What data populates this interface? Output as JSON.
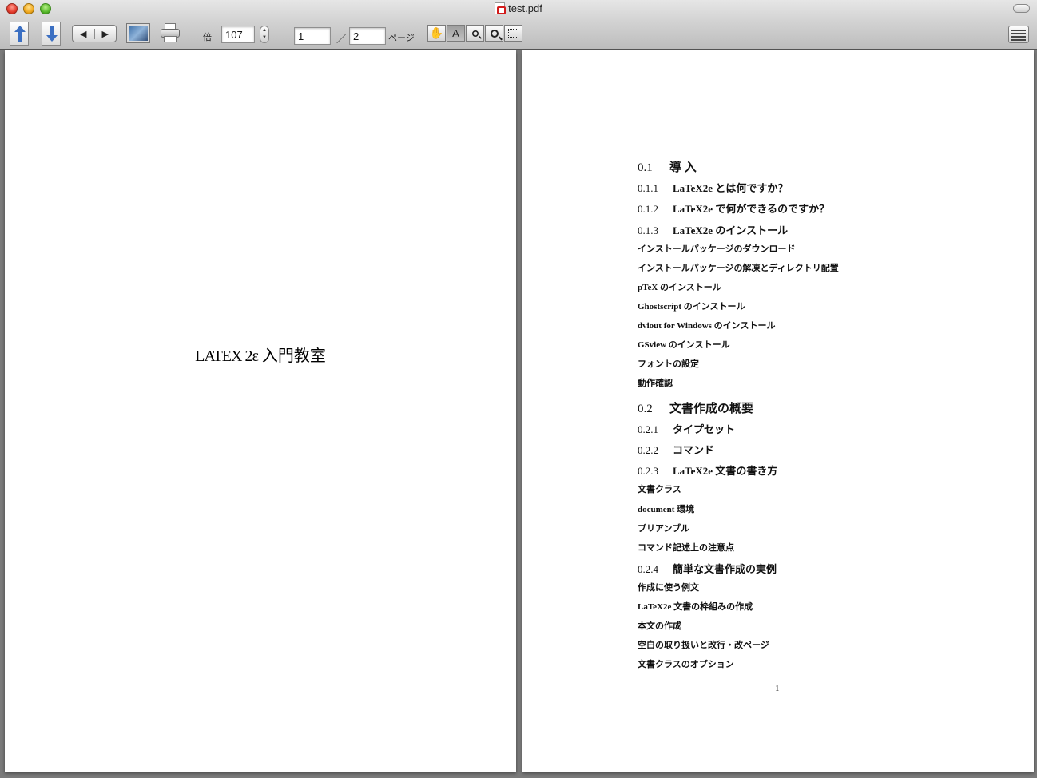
{
  "window": {
    "title": "test.pdf"
  },
  "toolbar": {
    "zoom_label": "倍",
    "zoom_value": "107",
    "page_current": "1",
    "page_separator": "／",
    "page_total": "2",
    "page_label": "ページ",
    "nav_back": "◀",
    "nav_forward": "▶",
    "text_tool_label": "A"
  },
  "icons": [
    "pdf-icon",
    "page-up-icon",
    "page-down-icon",
    "photo-icon",
    "printer-icon",
    "hand-icon",
    "text-select-icon",
    "zoom-in-icon",
    "zoom-out-icon",
    "marquee-icon",
    "sidebar-icon"
  ],
  "left_page": {
    "title_prefix": "LATEX 2ε",
    "title_main": "入門教室"
  },
  "right_page": {
    "toc": [
      {
        "level": 1,
        "num": "0.1",
        "text": "導 入"
      },
      {
        "level": 2,
        "num": "0.1.1",
        "text": "LaTeX2e とは何ですか？"
      },
      {
        "level": 2,
        "num": "0.1.2",
        "text": "LaTeX2e で何ができるのですか？"
      },
      {
        "level": 2,
        "num": "0.1.3",
        "text": "LaTeX2e のインストール"
      },
      {
        "level": 3,
        "num": "",
        "text": "インストールパッケージのダウンロード"
      },
      {
        "level": 3,
        "num": "",
        "text": "インストールパッケージの解凍とディレクトリ配置"
      },
      {
        "level": 3,
        "num": "",
        "text": "pTeX のインストール"
      },
      {
        "level": 3,
        "num": "",
        "text": "Ghostscript のインストール"
      },
      {
        "level": 3,
        "num": "",
        "text": "dviout for Windows のインストール"
      },
      {
        "level": 3,
        "num": "",
        "text": "GSview のインストール"
      },
      {
        "level": 3,
        "num": "",
        "text": "フォントの設定"
      },
      {
        "level": 3,
        "num": "",
        "text": "動作確認"
      },
      {
        "level": 1,
        "num": "0.2",
        "text": "文書作成の概要"
      },
      {
        "level": 2,
        "num": "0.2.1",
        "text": "タイプセット"
      },
      {
        "level": 2,
        "num": "0.2.2",
        "text": "コマンド"
      },
      {
        "level": 2,
        "num": "0.2.3",
        "text": "LaTeX2e 文書の書き方"
      },
      {
        "level": 3,
        "num": "",
        "text": "文書クラス"
      },
      {
        "level": 3,
        "num": "",
        "text": "document 環境"
      },
      {
        "level": 3,
        "num": "",
        "text": "プリアンブル"
      },
      {
        "level": 3,
        "num": "",
        "text": "コマンド記述上の注意点"
      },
      {
        "level": 2,
        "num": "0.2.4",
        "text": "簡単な文書作成の実例"
      },
      {
        "level": 3,
        "num": "",
        "text": "作成に使う例文"
      },
      {
        "level": 3,
        "num": "",
        "text": "LaTeX2e 文書の枠組みの作成"
      },
      {
        "level": 3,
        "num": "",
        "text": "本文の作成"
      },
      {
        "level": 3,
        "num": "",
        "text": "空白の取り扱いと改行・改ページ"
      },
      {
        "level": 3,
        "num": "",
        "text": "文書クラスのオプション"
      }
    ],
    "page_number": "1"
  }
}
